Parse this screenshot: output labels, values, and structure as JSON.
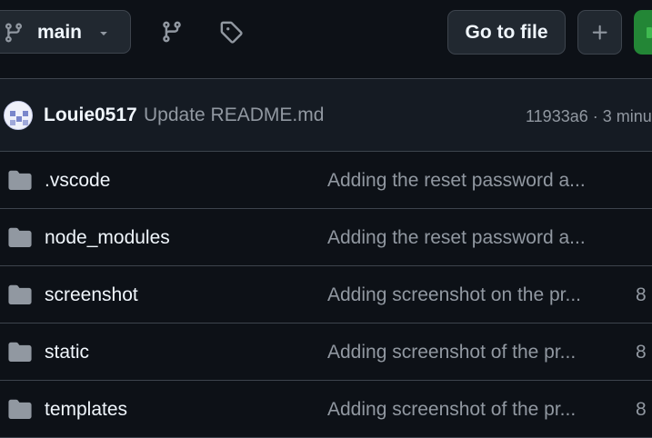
{
  "toolbar": {
    "branch": "main",
    "branch_icon": "git-branch-icon",
    "caret_icon": "triangle-down-icon",
    "branches_icon": "git-branch-icon",
    "tags_icon": "tag-icon",
    "goto_file_label": "Go to file",
    "add_icon": "plus-icon",
    "code_button_color": "#238636"
  },
  "latest_commit": {
    "author": "Louie0517",
    "message": "Update README.md",
    "hash_and_time": "11933a6 · 3 minu"
  },
  "files": [
    {
      "name": ".vscode",
      "commit": "Adding the reset password a...",
      "time": "",
      "icon": "folder-icon"
    },
    {
      "name": "node_modules",
      "commit": "Adding the reset password a...",
      "time": "",
      "icon": "folder-icon"
    },
    {
      "name": "screenshot",
      "commit": "Adding screenshot on the pr...",
      "time": "8",
      "icon": "folder-icon"
    },
    {
      "name": "static",
      "commit": "Adding screenshot of the pr...",
      "time": "8",
      "icon": "folder-icon"
    },
    {
      "name": "templates",
      "commit": "Adding screenshot of the pr...",
      "time": "8",
      "icon": "folder-icon"
    }
  ],
  "colors": {
    "background": "#0d1117",
    "commit_bar": "#151b23",
    "border": "#3d444d",
    "button": "#212830",
    "muted_text": "#9198a1",
    "text": "#f0f6fc",
    "folder": "#9198a1"
  }
}
